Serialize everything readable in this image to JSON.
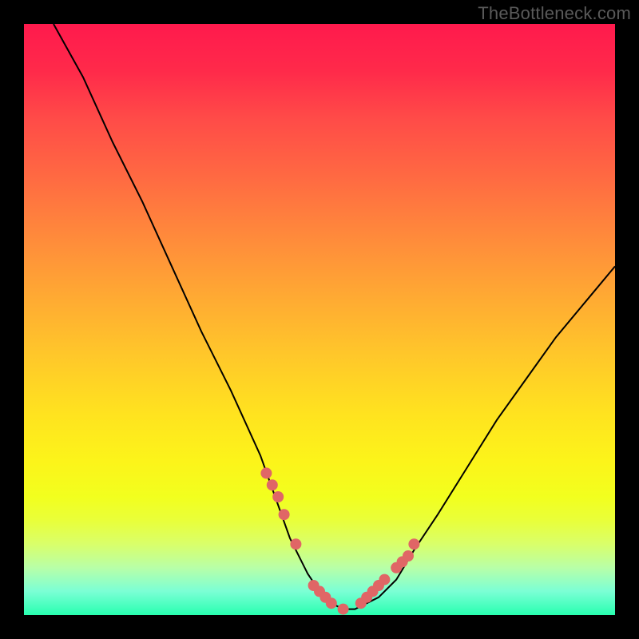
{
  "watermark": "TheBottleneck.com",
  "chart_data": {
    "type": "line",
    "title": "",
    "xlabel": "",
    "ylabel": "",
    "xlim": [
      0,
      100
    ],
    "ylim": [
      0,
      100
    ],
    "series": [
      {
        "name": "bottleneck-curve",
        "x": [
          5,
          10,
          15,
          20,
          25,
          30,
          35,
          40,
          45,
          48,
          50,
          52,
          54,
          56,
          58,
          60,
          63,
          66,
          70,
          75,
          80,
          85,
          90,
          95,
          100
        ],
        "values": [
          100,
          91,
          80,
          70,
          59,
          48,
          38,
          27,
          13,
          7,
          4,
          2,
          1,
          1,
          2,
          3,
          6,
          11,
          17,
          25,
          33,
          40,
          47,
          53,
          59
        ]
      }
    ],
    "markers": {
      "name": "highlight-points",
      "x": [
        41,
        42,
        43,
        44,
        46,
        49,
        50,
        51,
        52,
        54,
        57,
        58,
        59,
        60,
        61,
        63,
        64,
        65,
        66
      ],
      "values": [
        24,
        22,
        20,
        17,
        12,
        5,
        4,
        3,
        2,
        1,
        2,
        3,
        4,
        5,
        6,
        8,
        9,
        10,
        12
      ]
    },
    "colors": {
      "curve": "#000000",
      "marker": "#e06666",
      "gradient_top": "#ff1a4d",
      "gradient_bottom": "#28ffb0"
    }
  }
}
